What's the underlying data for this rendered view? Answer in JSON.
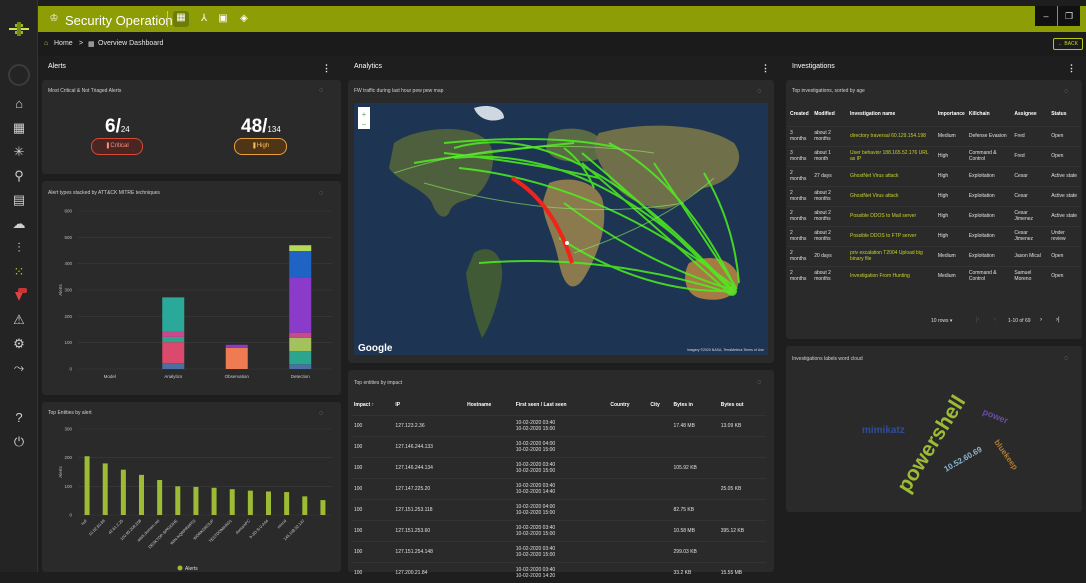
{
  "app": {
    "title": "Security Operations",
    "accent": "#8c9d06",
    "back_label": "BACK"
  },
  "breadcrumb": {
    "home": "Home",
    "separator": ">",
    "current": "Overview Dashboard"
  },
  "window": {
    "minimize": "–",
    "restore": "❐"
  },
  "alerts": {
    "title": "Alerts",
    "card_title": "Most Critical & Not Triaged Alerts",
    "critical": {
      "count": "6",
      "total": "24",
      "label": "Critical",
      "color": "#d84a35"
    },
    "high": {
      "count": "48",
      "total": "134",
      "label": "High",
      "color": "#e9a040"
    },
    "stacked_title": "Alert types stacked by ATT&CK MITRE techniques",
    "top_entities_title": "Top Entities by alert"
  },
  "analytics": {
    "title": "Analytics",
    "map_title": "FW traffic during last hour pew pew map",
    "map_brand": "Google",
    "map_attribution": "Imagery ©2020 NASA, TerraMetrics   Terms of Use",
    "entities_title": "Top entities by impact",
    "entities_columns": [
      "Impact ↑",
      "IP",
      "Hostname",
      "First seen / Last seen",
      "Country",
      "City",
      "Bytes in",
      "Bytes out"
    ],
    "entities_rows": [
      {
        "impact": "100",
        "ip": "127.123.2.36",
        "hostname": "",
        "seen": "10-02-2020 03:40\n10-02-2020 15:00",
        "country": "",
        "city": "",
        "bytes_in": "17.48 MB",
        "bytes_out": "13.09 KB"
      },
      {
        "impact": "100",
        "ip": "127.146.244.133",
        "hostname": "",
        "seen": "10-02-2020 04:00\n10-02-2020 15:00",
        "country": "",
        "city": "",
        "bytes_in": "",
        "bytes_out": ""
      },
      {
        "impact": "100",
        "ip": "127.146.244.134",
        "hostname": "",
        "seen": "10-02-2020 03:40\n10-02-2020 15:00",
        "country": "",
        "city": "",
        "bytes_in": "105.92 KB",
        "bytes_out": ""
      },
      {
        "impact": "100",
        "ip": "127.147.225.20",
        "hostname": "",
        "seen": "10-02-2020 03:40\n10-02-2020 14:40",
        "country": "",
        "city": "",
        "bytes_in": "",
        "bytes_out": "25.05 KB"
      },
      {
        "impact": "100",
        "ip": "127.151.253.118",
        "hostname": "",
        "seen": "10-02-2020 04:00\n10-02-2020 15:00",
        "country": "",
        "city": "",
        "bytes_in": "82.75 KB",
        "bytes_out": ""
      },
      {
        "impact": "100",
        "ip": "127.151.253.60",
        "hostname": "",
        "seen": "10-02-2020 03:40\n10-02-2020 15:00",
        "country": "",
        "city": "",
        "bytes_in": "10.58 MB",
        "bytes_out": "395.12 KB"
      },
      {
        "impact": "100",
        "ip": "127.151.254.148",
        "hostname": "",
        "seen": "10-02-2020 03:40\n10-02-2020 15:00",
        "country": "",
        "city": "",
        "bytes_in": "299.03 KB",
        "bytes_out": ""
      },
      {
        "impact": "100",
        "ip": "127.200.21.84",
        "hostname": "",
        "seen": "10-02-2020 03:40\n10-02-2020 14:20",
        "country": "",
        "city": "",
        "bytes_in": "33.2 KB",
        "bytes_out": "15.55 MB"
      }
    ]
  },
  "investigations": {
    "title": "Investigations",
    "table_title": "Top investigations, sorted by age",
    "columns": [
      "Created",
      "Modified",
      "Investigation name",
      "Importance",
      "Killchain",
      "Assignee",
      "Status"
    ],
    "rows": [
      {
        "created": "3 months",
        "modified": "about 2 months",
        "name": "directory traversal 60.129.154.198",
        "importance": "Medium",
        "killchain": "Defense Evasion",
        "assignee": "Fred",
        "status": "Open"
      },
      {
        "created": "3 months",
        "modified": "about 1 month",
        "name": "User behavior 188.165.52.176 URL as IP",
        "importance": "High",
        "killchain": "Command & Control",
        "assignee": "Fred",
        "status": "Open"
      },
      {
        "created": "2 months",
        "modified": "27 days",
        "name": "GhostNet Virus attack",
        "importance": "High",
        "killchain": "Exploitation",
        "assignee": "Cesar",
        "status": "Active state"
      },
      {
        "created": "2 months",
        "modified": "about 2 months",
        "name": "GhostNet Virus attack",
        "importance": "High",
        "killchain": "Exploitation",
        "assignee": "Cesar",
        "status": "Active state"
      },
      {
        "created": "2 months",
        "modified": "about 2 months",
        "name": "Possible DDOS to Mail server",
        "importance": "High",
        "killchain": "Exploitation",
        "assignee": "Cesar Jimenez",
        "status": "Active state"
      },
      {
        "created": "2 months",
        "modified": "about 2 months",
        "name": "Possible DDOS to FTP server",
        "importance": "High",
        "killchain": "Exploitation",
        "assignee": "Cesar Jimenez",
        "status": "Under review"
      },
      {
        "created": "2 months",
        "modified": "20 days",
        "name": "priv escalation T2004 Upload big binary file",
        "importance": "Medium",
        "killchain": "Exploitation",
        "assignee": "Jason Mical",
        "status": "Open"
      },
      {
        "created": "2 months",
        "modified": "about 2 months",
        "name": "Investigation From Hunting",
        "importance": "Medium",
        "killchain": "Command & Control",
        "assignee": "Samuel Moreno",
        "status": "Open"
      }
    ],
    "pagination": {
      "rows_label": "10 rows",
      "range": "1-10 of 69"
    },
    "wordcloud_title": "Investigations labels word cloud",
    "words": [
      {
        "text": "powershell",
        "color": "#9dbb35"
      },
      {
        "text": "mimikatz",
        "color": "#2f4c95"
      },
      {
        "text": "10.52.60.69",
        "color": "#8ab6d0"
      },
      {
        "text": "power",
        "color": "#6a4ca3"
      },
      {
        "text": "bluekeep",
        "color": "#b07c2b"
      },
      {
        "text": "",
        "color": "#9dbb35"
      }
    ]
  },
  "chart_data": [
    {
      "type": "bar",
      "stacked": true,
      "title": "Alert types stacked by ATT&CK MITRE techniques",
      "categories": [
        "Model",
        "Analytics",
        "Observation",
        "Detection"
      ],
      "ylabel": "Alerts",
      "ylim": [
        0,
        600
      ],
      "yticks": [
        0,
        100,
        200,
        300,
        400,
        500,
        600
      ],
      "grid": true,
      "series": [
        {
          "color": "#4a6fa0",
          "values": [
            0,
            22,
            0,
            18
          ]
        },
        {
          "color": "#d94a6c",
          "values": [
            0,
            80,
            0,
            0
          ]
        },
        {
          "color": "#ef7b52",
          "values": [
            0,
            0,
            80,
            0
          ]
        },
        {
          "color": "#2ba58d",
          "values": [
            0,
            20,
            0,
            50
          ]
        },
        {
          "color": "#a3c15c",
          "values": [
            0,
            0,
            0,
            50
          ]
        },
        {
          "color": "#c84a8a",
          "values": [
            0,
            20,
            0,
            20
          ]
        },
        {
          "color": "#2aa99a",
          "values": [
            0,
            130,
            0,
            0
          ]
        },
        {
          "color": "#8a3bc9",
          "values": [
            0,
            0,
            12,
            210
          ]
        },
        {
          "color": "#1f63c4",
          "values": [
            0,
            0,
            0,
            100
          ]
        },
        {
          "color": "#b6d957",
          "values": [
            0,
            0,
            0,
            22
          ]
        }
      ]
    },
    {
      "type": "bar",
      "title": "Top Entities by alert",
      "categories": [
        "null",
        "10.52.60.69",
        "42.61.2.25",
        "100.93.209.208",
        "ads5.domain.net",
        "DESKTOP-SPK5GHE",
        "WIN-KQRPRWPGI",
        "WORKGROUP",
        "TESTDOMAIN01",
        "domainPC",
        "b-3D-S-0-A44",
        "minnd",
        "145.108.52.147"
      ],
      "values": [
        205,
        180,
        158,
        140,
        122,
        100,
        98,
        95,
        90,
        85,
        82,
        80,
        65,
        52
      ],
      "ylabel": "Alerts",
      "ylim": [
        0,
        300
      ],
      "yticks": [
        0,
        100,
        200,
        300
      ],
      "legend": "Alerts",
      "legend_position": "bottom",
      "color": "#9dbb35",
      "grid": true
    }
  ]
}
